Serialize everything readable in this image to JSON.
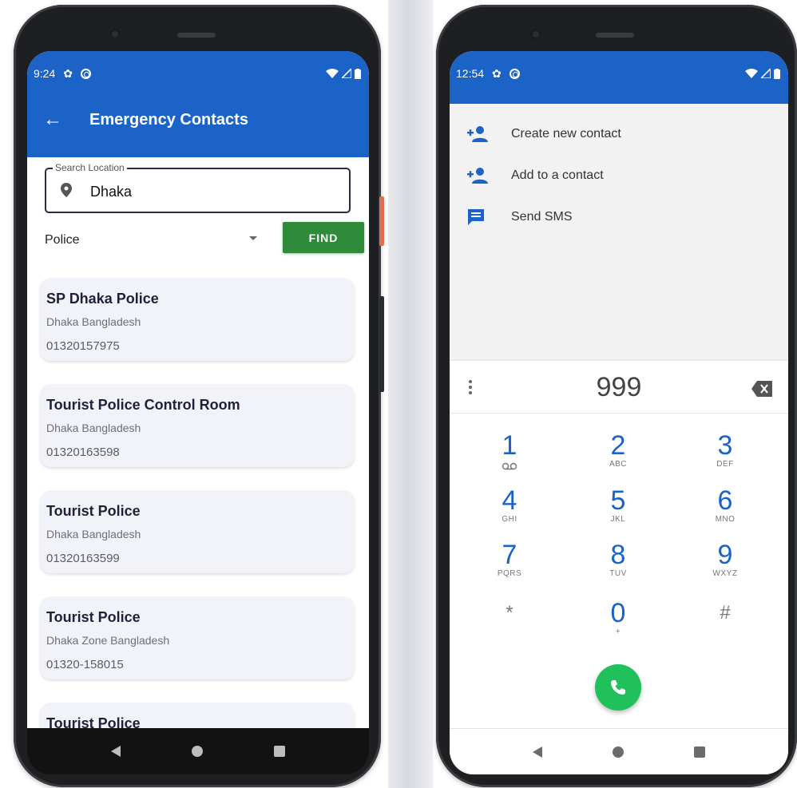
{
  "left_phone": {
    "status_time": "9:24",
    "app_title": "Emergency Contacts",
    "search": {
      "legend": "Search Location",
      "value": "Dhaka"
    },
    "filter": {
      "selected": "Police",
      "find_label": "FIND"
    },
    "contacts": [
      {
        "name": "SP Dhaka Police",
        "location": "Dhaka Bangladesh",
        "phone": "01320157975"
      },
      {
        "name": "Tourist Police Control Room",
        "location": "Dhaka Bangladesh",
        "phone": "01320163598"
      },
      {
        "name": "Tourist Police",
        "location": "Dhaka Bangladesh",
        "phone": "01320163599"
      },
      {
        "name": "Tourist Police",
        "location": "Dhaka Zone Bangladesh",
        "phone": "01320-158015"
      },
      {
        "name": "Tourist Police",
        "location": "",
        "phone": ""
      }
    ]
  },
  "right_phone": {
    "status_time": "12:54",
    "menu": [
      {
        "label": "Create new contact",
        "icon": "add-person-icon"
      },
      {
        "label": "Add to a contact",
        "icon": "add-person-icon"
      },
      {
        "label": "Send SMS",
        "icon": "message-icon"
      }
    ],
    "dialed_number": "999",
    "keypad": [
      {
        "digit": "1",
        "letters": ""
      },
      {
        "digit": "2",
        "letters": "ABC"
      },
      {
        "digit": "3",
        "letters": "DEF"
      },
      {
        "digit": "4",
        "letters": "GHI"
      },
      {
        "digit": "5",
        "letters": "JKL"
      },
      {
        "digit": "6",
        "letters": "MNO"
      },
      {
        "digit": "7",
        "letters": "PQRS"
      },
      {
        "digit": "8",
        "letters": "TUV"
      },
      {
        "digit": "9",
        "letters": "WXYZ"
      },
      {
        "digit": "*",
        "letters": ""
      },
      {
        "digit": "0",
        "letters": "+"
      },
      {
        "digit": "#",
        "letters": ""
      }
    ]
  },
  "colors": {
    "primary_blue": "#1b63c6",
    "find_green": "#2e8b3a",
    "call_green": "#20c15a",
    "card_bg": "#f1f3f8"
  }
}
